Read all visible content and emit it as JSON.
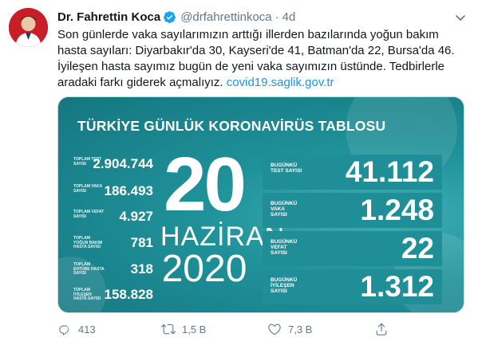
{
  "tweet": {
    "display_name": "Dr. Fahrettin Koca",
    "handle": "@drfahrettinkoca",
    "separator": "·",
    "time": "4d",
    "text": "Son günlerde vaka sayılarımızın arttığı illerden bazılarında yoğun bakım hasta sayıları: Diyarbakır'da 30, Kayseri'de 41, Batman'da 22, Bursa'da 46. İyileşen hasta sayımız bugün de yeni vaka sayımızın üstünde. Tedbirlerle aradaki farkı giderek açmalıyız. ",
    "link": "covid19.saglik.gov.tr"
  },
  "card": {
    "title": "TÜRKİYE GÜNLÜK KORONAVİRÜS TABLOSU",
    "date": {
      "day": "20",
      "month": "HAZİRAN",
      "year": "2020"
    },
    "totals": [
      {
        "label": "TOPLAM TEST SAYISI",
        "value": "2.904.744"
      },
      {
        "label": "TOPLAM VAKA SAYISI",
        "value": "186.493"
      },
      {
        "label": "TOPLAM VEFAT SAYISI",
        "value": "4.927"
      },
      {
        "label": "TOPLAM YOĞUN BAKIM HASTA SAYISI",
        "value": "781"
      },
      {
        "label": "TOPLAM ENTÜBE HASTA SAYISI",
        "value": "318"
      },
      {
        "label": "TOPLAM İYİLEŞEN HASTA SAYISI",
        "value": "158.828"
      }
    ],
    "daily": [
      {
        "label": "BUGÜNKÜ TEST SAYISI",
        "value": "41.112"
      },
      {
        "label": "BUGÜNKÜ VAKA SAYISI",
        "value": "1.248"
      },
      {
        "label": "BUGÜNKÜ VEFAT SAYISI",
        "value": "22"
      },
      {
        "label": "BUGÜNKÜ İYİLEŞEN SAYISI",
        "value": "1.312"
      }
    ]
  },
  "actions": {
    "reply_count": "413",
    "retweet_count": "1,5 B",
    "like_count": "7,3 B"
  },
  "colors": {
    "card_bg": "#1d8a93",
    "link": "#1b95e0",
    "verified": "#1da1f2"
  }
}
